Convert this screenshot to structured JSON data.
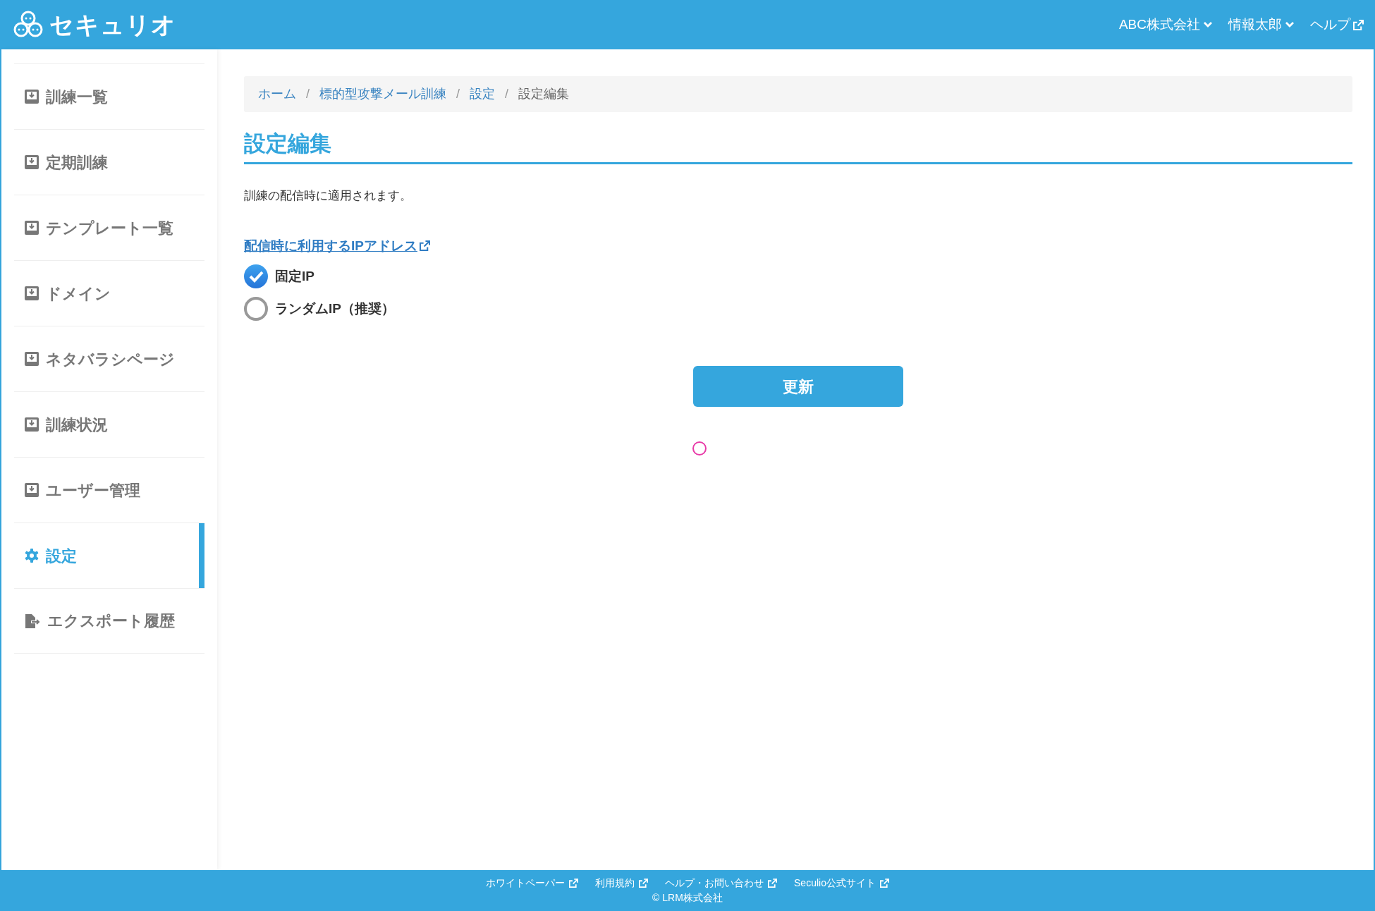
{
  "header": {
    "logo_text": "セキュリオ",
    "menu": [
      {
        "label": "ABC株式会社",
        "kind": "dropdown"
      },
      {
        "label": "情報太郎",
        "kind": "dropdown"
      },
      {
        "label": "ヘルプ",
        "kind": "external"
      }
    ]
  },
  "sidebar": {
    "items": [
      {
        "label": "訓練一覧",
        "kind": "page",
        "selected": false
      },
      {
        "label": "定期訓練",
        "kind": "page",
        "selected": false
      },
      {
        "label": "テンプレート一覧",
        "kind": "page",
        "selected": false
      },
      {
        "label": "ドメイン",
        "kind": "page",
        "selected": false
      },
      {
        "label": "ネタバラシページ",
        "kind": "page",
        "selected": false
      },
      {
        "label": "訓練状況",
        "kind": "page",
        "selected": false
      },
      {
        "label": "ユーザー管理",
        "kind": "page",
        "selected": false
      },
      {
        "label": "設定",
        "kind": "settings",
        "selected": true
      },
      {
        "label": "エクスポート履歴",
        "kind": "export",
        "selected": false
      }
    ]
  },
  "breadcrumb_separator": "/",
  "breadcrumb": [
    {
      "label": "ホーム",
      "current": false
    },
    {
      "label": "標的型攻撃メール訓練",
      "current": false
    },
    {
      "label": "設定",
      "current": false
    },
    {
      "label": "設定編集",
      "current": true
    }
  ],
  "page_title": "設定編集",
  "description": "訓練の配信時に適用されます。",
  "ip_section": {
    "link": "配信時に利用するIPアドレス",
    "options": [
      {
        "label": "固定IP",
        "selected": true
      },
      {
        "label": "ランダムIP（推奨）",
        "selected": false
      }
    ]
  },
  "submit_button": "更新",
  "footer": {
    "links": [
      "ホワイトペーパー",
      "利用規約",
      "ヘルプ・お問い合わせ",
      "Seculio公式サイト"
    ],
    "copyright": "© LRM株式会社"
  }
}
